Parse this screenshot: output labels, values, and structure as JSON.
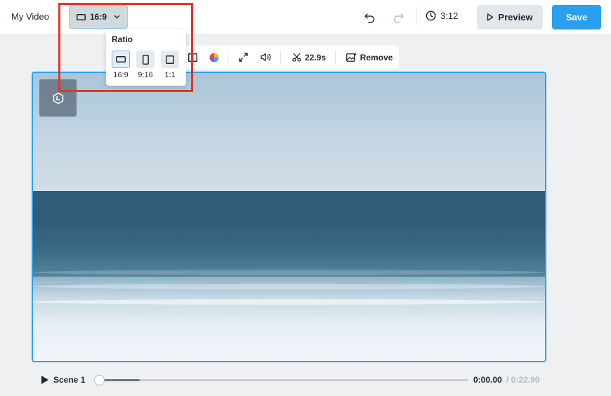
{
  "header": {
    "project_title": "My Video",
    "ratio_button_label": "16:9",
    "duration": "3:12",
    "preview_label": "Preview",
    "save_label": "Save"
  },
  "ratio_popup": {
    "title": "Ratio",
    "options": [
      {
        "label": "16:9",
        "selected": true
      },
      {
        "label": "9:16",
        "selected": false
      },
      {
        "label": "1:1",
        "selected": false
      }
    ]
  },
  "toolbar": {
    "trim_duration": "22.9s",
    "remove_label": "Remove"
  },
  "timeline": {
    "scene_label": "Scene 1",
    "current_time": "0:00.00",
    "total_time": "/ 0:22.90",
    "progress_fraction": 0.11
  },
  "colors": {
    "accent": "#2a9ff0",
    "highlight": "#e5342a"
  }
}
